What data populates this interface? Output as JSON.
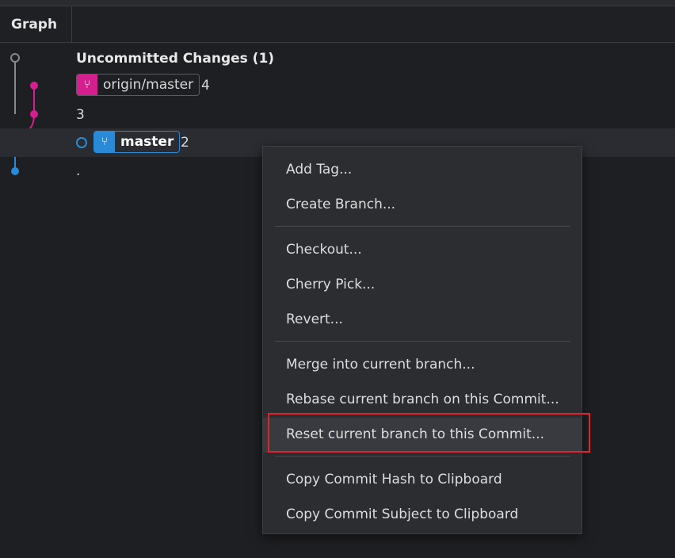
{
  "header": {
    "graph_label": "Graph"
  },
  "rows": [
    {
      "text": "Uncommitted Changes (1)"
    },
    {
      "branch": "origin/master",
      "message": "4"
    },
    {
      "message": "3"
    },
    {
      "branch": "master",
      "message": "2"
    },
    {
      "message": "."
    }
  ],
  "context_menu": {
    "add_tag": "Add Tag...",
    "create_branch": "Create Branch...",
    "checkout": "Checkout...",
    "cherry_pick": "Cherry Pick...",
    "revert": "Revert...",
    "merge": "Merge into current branch...",
    "rebase": "Rebase current branch on this Commit...",
    "reset": "Reset current branch to this Commit...",
    "copy_hash": "Copy Commit Hash to Clipboard",
    "copy_subject": "Copy Commit Subject to Clipboard"
  },
  "colors": {
    "origin_branch": "#d61f8e",
    "master_branch": "#2a8ad8",
    "uncommitted": "#888888",
    "highlight": "#e0242b"
  }
}
